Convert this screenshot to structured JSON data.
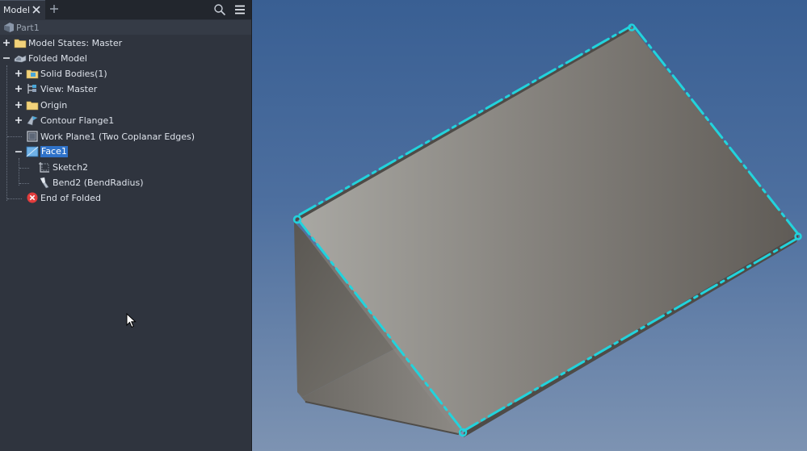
{
  "browser": {
    "tab_label": "Model",
    "root": "Part1",
    "nodes": [
      {
        "label": "Model States: Master",
        "icon": "folder-icon",
        "expander": "plus"
      },
      {
        "label": "Folded Model",
        "icon": "folded-model-icon",
        "expander": "minus"
      },
      {
        "label": "Solid Bodies(1)",
        "icon": "solid-bodies-folder-icon",
        "expander": "plus"
      },
      {
        "label": "View: Master",
        "icon": "view-icon",
        "expander": "plus"
      },
      {
        "label": "Origin",
        "icon": "folder-icon",
        "expander": "plus"
      },
      {
        "label": "Contour Flange1",
        "icon": "contour-flange-icon",
        "expander": "plus"
      },
      {
        "label": "Work Plane1 (Two Coplanar Edges)",
        "icon": "work-plane-icon",
        "expander": "none"
      },
      {
        "label": "Face1",
        "icon": "face-icon",
        "expander": "minus",
        "selected": true
      },
      {
        "label": "Sketch2",
        "icon": "sketch-icon",
        "expander": "none"
      },
      {
        "label": "Bend2 (BendRadius)",
        "icon": "bend-icon",
        "expander": "none"
      },
      {
        "label": "End of Folded",
        "icon": "end-of-part-icon",
        "expander": "none"
      }
    ]
  },
  "colors": {
    "selection_highlight": "#2f72c9",
    "edge_highlight": "#22d3dc",
    "end_marker": "#e23c3c",
    "folder": "#f2d27a"
  }
}
